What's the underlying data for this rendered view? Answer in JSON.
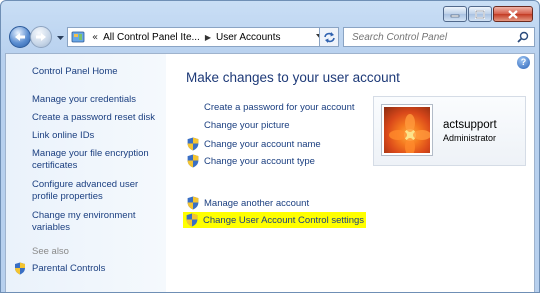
{
  "window": {
    "caption_buttons": [
      "minimize",
      "maximize",
      "close"
    ]
  },
  "address_bar": {
    "overflow": "«",
    "crumbs": [
      "All Control Panel Ite...",
      "User Accounts"
    ]
  },
  "search": {
    "placeholder": "Search Control Panel"
  },
  "left_pane": {
    "home": "Control Panel Home",
    "items": [
      "Manage your credentials",
      "Create a password reset disk",
      "Link online IDs",
      "Manage your file encryption certificates",
      "Configure advanced user profile properties",
      "Change my environment variables"
    ],
    "see_also": "See also",
    "parental_controls": "Parental Controls"
  },
  "help": "?",
  "main": {
    "title": "Make changes to your user account",
    "tasks": [
      "Create a password for your account",
      "Change your picture",
      "Change your account name",
      "Change your account type"
    ],
    "other_tasks": [
      "Manage another account",
      "Change User Account Control settings"
    ]
  },
  "account": {
    "name": "actsupport",
    "role": "Administrator"
  },
  "colors": {
    "link": "#1b3f80",
    "title": "#1e3a78",
    "highlight": "#ffff00"
  },
  "icons": [
    "back-arrow-icon",
    "forward-arrow-icon",
    "control-panel-icon",
    "refresh-icon",
    "search-icon",
    "shield-icon",
    "help-icon"
  ]
}
